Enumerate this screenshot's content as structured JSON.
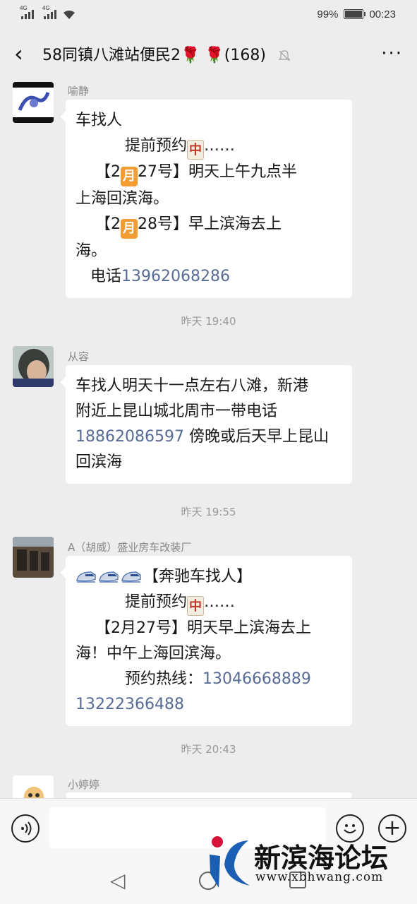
{
  "status_bar": {
    "signal1_tag": "4G",
    "signal2_tag": "4G",
    "battery_pct": "99%",
    "battery_level": 0.99,
    "time": "00:23"
  },
  "header": {
    "back_icon": "chevron-left-icon",
    "title": "58同镇八滩站便民2🌹 🌹(168)",
    "muted_icon": "bell-off-icon",
    "more_icon": "more-dots-icon"
  },
  "messages": [
    {
      "sender": "喻静",
      "lines": [
        {
          "parts": [
            {
              "t": "车找人"
            }
          ]
        },
        {
          "parts": [
            {
              "t": "          提前预约"
            },
            {
              "e": "中",
              "k": "mj"
            },
            {
              "t": "……"
            }
          ]
        },
        {
          "parts": [
            {
              "t": "    【2"
            },
            {
              "e": "月",
              "k": "cal"
            },
            {
              "t": "27号】明天上午九点半"
            }
          ]
        },
        {
          "parts": [
            {
              "t": "上海回滨海。"
            }
          ]
        },
        {
          "parts": [
            {
              "t": "    【2"
            },
            {
              "e": "月",
              "k": "cal"
            },
            {
              "t": "28号】早上滨海去上"
            }
          ]
        },
        {
          "parts": [
            {
              "t": "海。"
            }
          ]
        },
        {
          "parts": [
            {
              "t": "   电话"
            },
            {
              "l": "13962068286"
            }
          ]
        }
      ]
    },
    {
      "time": "昨天 19:40",
      "sender": "从容",
      "lines": [
        {
          "parts": [
            {
              "t": "车找人明天十一点左右八滩，新港"
            }
          ]
        },
        {
          "parts": [
            {
              "t": "附近上昆山城北周市一带电话"
            }
          ]
        },
        {
          "parts": [
            {
              "l": "18862086597"
            },
            {
              "t": " 傍晚或后天早上昆山"
            }
          ]
        },
        {
          "parts": [
            {
              "t": "回滨海"
            }
          ]
        }
      ]
    },
    {
      "time": "昨天 19:55",
      "sender": "A（胡威）盛业房车改装厂",
      "lines": [
        {
          "parts": [
            {
              "train": 3
            },
            {
              "t": "【奔驰车找人】"
            }
          ]
        },
        {
          "parts": [
            {
              "t": "          提前预约"
            },
            {
              "e": "中",
              "k": "mj"
            },
            {
              "t": "……"
            }
          ]
        },
        {
          "parts": [
            {
              "t": "    【2月27号】明天早上滨海去上"
            }
          ]
        },
        {
          "parts": [
            {
              "t": "海！中午上海回滨海。"
            }
          ]
        },
        {
          "parts": [
            {
              "t": "          预约热线："
            },
            {
              "l": "13046668889"
            }
          ]
        },
        {
          "parts": [
            {
              "l": "13222366488"
            }
          ]
        }
      ]
    },
    {
      "time": "昨天 20:43",
      "sender": "小婷婷",
      "lines": []
    }
  ],
  "input_bar": {
    "voice_icon": "voice-icon",
    "emoji_icon": "emoji-icon",
    "plus_icon": "plus-icon",
    "placeholder": ""
  },
  "watermark": {
    "title": "新滨海论坛",
    "url": "www.xbhwang.com"
  },
  "colors": {
    "background": "#ededed",
    "bubble": "#ffffff",
    "link": "#576b95",
    "timestamp": "#999999"
  }
}
